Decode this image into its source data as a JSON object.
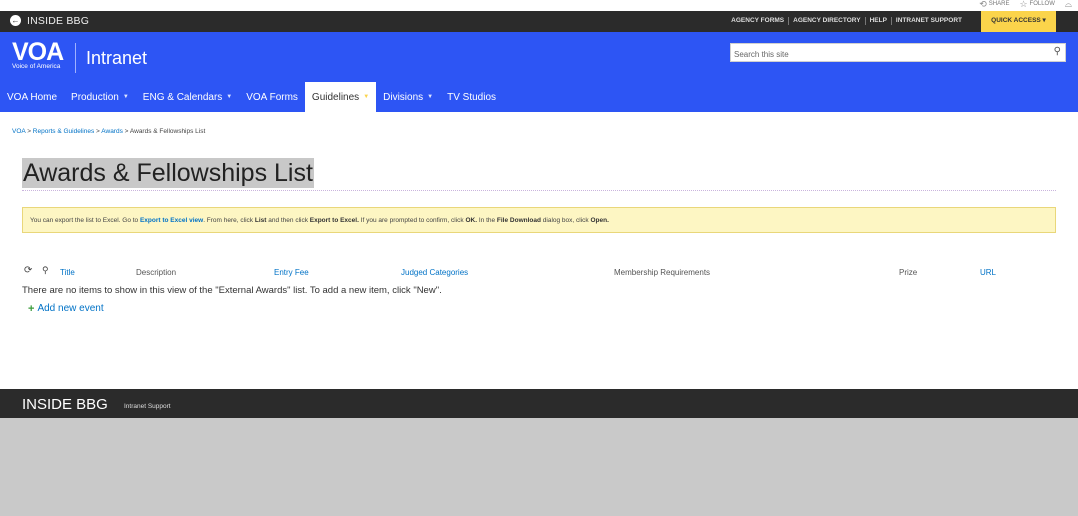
{
  "util": {
    "share": "SHARE",
    "follow": "FOLLOW"
  },
  "topbar": {
    "title": "INSIDE BBG",
    "links": [
      "AGENCY FORMS",
      "AGENCY DIRECTORY",
      "HELP",
      "INTRANET SUPPORT"
    ],
    "quick_access": "QUICK ACCESS ▾"
  },
  "header": {
    "logo": "VOA",
    "logo_sub": "Voice of America",
    "site_name": "Intranet",
    "search_placeholder": "Search this site"
  },
  "nav": [
    {
      "label": "VOA Home",
      "dropdown": false,
      "active": false
    },
    {
      "label": "Production",
      "dropdown": true,
      "active": false
    },
    {
      "label": "ENG & Calendars",
      "dropdown": true,
      "active": false
    },
    {
      "label": "VOA Forms",
      "dropdown": false,
      "active": false
    },
    {
      "label": "Guidelines",
      "dropdown": true,
      "active": true
    },
    {
      "label": "Divisions",
      "dropdown": true,
      "active": false
    },
    {
      "label": "TV Studios",
      "dropdown": false,
      "active": false
    }
  ],
  "breadcrumb": {
    "items": [
      "VOA",
      "Reports & Guidelines",
      "Awards"
    ],
    "current": "Awards & Fellowships List",
    "separator": ">"
  },
  "page": {
    "title": "Awards & Fellowships List"
  },
  "notice": {
    "t1": "You can export the list to Excel. Go to ",
    "link": "Export to Excel view",
    "t2": ". From here, click ",
    "b1": "List",
    "t3": " and then click ",
    "b2": "Export to Excel.",
    "t4": " If you are prompted to confirm, click ",
    "b3": "OK.",
    "t5": " In the ",
    "b4": "File Download",
    "t6": " dialog box, click ",
    "b5": "Open."
  },
  "list": {
    "columns": [
      "Title",
      "Description",
      "Entry Fee",
      "Judged Categories",
      "Membership Requirements",
      "Prize",
      "URL"
    ],
    "empty_message": "There are no items to show in this view of the \"External Awards\" list. To add a new item, click \"New\".",
    "add_label": "Add new event"
  },
  "footer": {
    "title": "INSIDE BBG",
    "link": "Intranet Support"
  },
  "colors": {
    "brand_blue": "#2d55f4",
    "quick_access": "#fbd44b",
    "dark_bar": "#2b2b2b",
    "link": "#0072c6"
  }
}
